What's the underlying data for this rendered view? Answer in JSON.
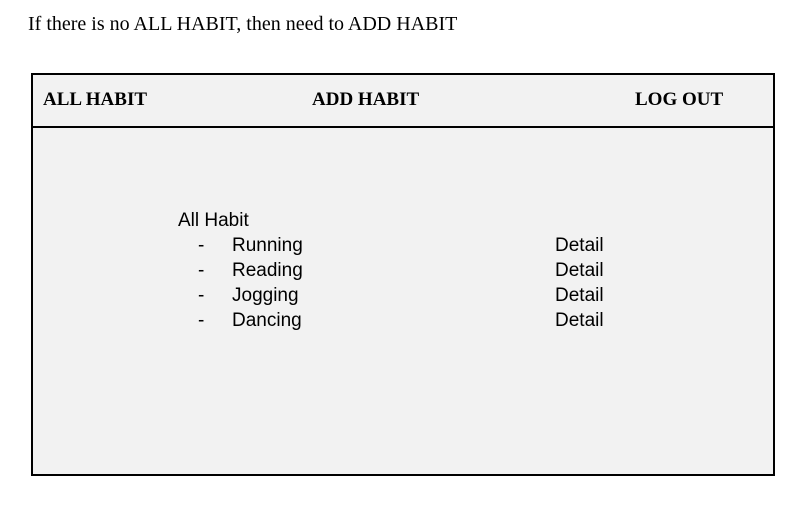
{
  "note": "If there is no ALL HABIT, then need to ADD HABIT",
  "nav": {
    "all_habit": "ALL HABIT",
    "add_habit": "ADD HABIT",
    "log_out": "LOG OUT"
  },
  "list": {
    "title": "All Habit",
    "bullet": "-",
    "detail_label": "Detail",
    "items": [
      {
        "name": "Running"
      },
      {
        "name": "Reading"
      },
      {
        "name": "Jogging"
      },
      {
        "name": "Dancing"
      }
    ]
  }
}
